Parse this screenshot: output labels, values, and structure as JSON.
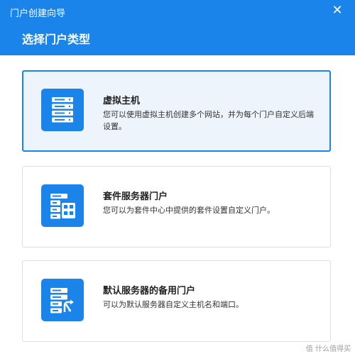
{
  "window": {
    "title": "门户创建向导",
    "close_icon": "close-icon"
  },
  "step": {
    "title": "选择门户类型"
  },
  "options": [
    {
      "title": "虚拟主机",
      "description": "您可以使用虚拟主机创建多个网站，并为每个门户自定义后端设置。",
      "icon": "server-stack-icon",
      "selected": true
    },
    {
      "title": "套件服务器门户",
      "description": "您可以为套件中心中提供的套件设置自定义门户。",
      "icon": "server-package-icon",
      "selected": false
    },
    {
      "title": "默认服务器的备用门户",
      "description": "可以为默认服务器自定义主机名和端口。",
      "icon": "server-redirect-icon",
      "selected": false
    }
  ],
  "watermark": "值 什么值得买",
  "colors": {
    "accent": "#1a84ea",
    "selected_background": "#eef4fc",
    "card_border": "#dedede"
  }
}
